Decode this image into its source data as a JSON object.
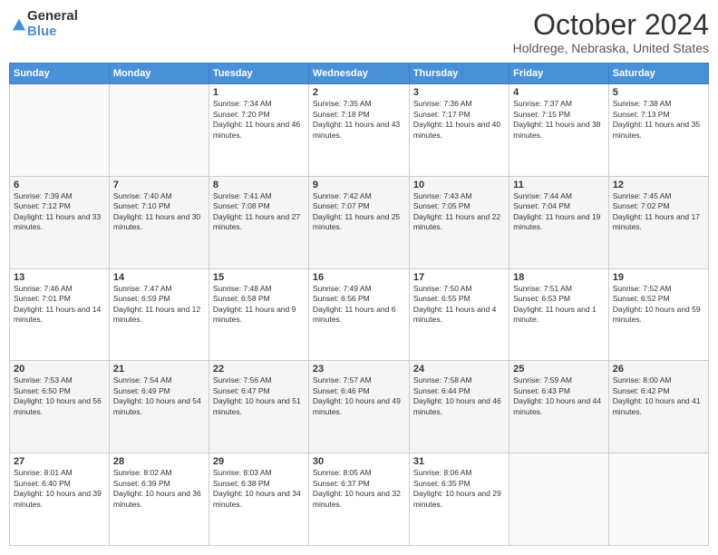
{
  "header": {
    "logo": {
      "general": "General",
      "blue": "Blue"
    },
    "title": "October 2024",
    "location": "Holdrege, Nebraska, United States"
  },
  "calendar": {
    "days_of_week": [
      "Sunday",
      "Monday",
      "Tuesday",
      "Wednesday",
      "Thursday",
      "Friday",
      "Saturday"
    ],
    "weeks": [
      [
        {
          "day": "",
          "info": ""
        },
        {
          "day": "",
          "info": ""
        },
        {
          "day": "1",
          "sunrise": "Sunrise: 7:34 AM",
          "sunset": "Sunset: 7:20 PM",
          "daylight": "Daylight: 11 hours and 46 minutes."
        },
        {
          "day": "2",
          "sunrise": "Sunrise: 7:35 AM",
          "sunset": "Sunset: 7:18 PM",
          "daylight": "Daylight: 11 hours and 43 minutes."
        },
        {
          "day": "3",
          "sunrise": "Sunrise: 7:36 AM",
          "sunset": "Sunset: 7:17 PM",
          "daylight": "Daylight: 11 hours and 40 minutes."
        },
        {
          "day": "4",
          "sunrise": "Sunrise: 7:37 AM",
          "sunset": "Sunset: 7:15 PM",
          "daylight": "Daylight: 11 hours and 38 minutes."
        },
        {
          "day": "5",
          "sunrise": "Sunrise: 7:38 AM",
          "sunset": "Sunset: 7:13 PM",
          "daylight": "Daylight: 11 hours and 35 minutes."
        }
      ],
      [
        {
          "day": "6",
          "sunrise": "Sunrise: 7:39 AM",
          "sunset": "Sunset: 7:12 PM",
          "daylight": "Daylight: 11 hours and 33 minutes."
        },
        {
          "day": "7",
          "sunrise": "Sunrise: 7:40 AM",
          "sunset": "Sunset: 7:10 PM",
          "daylight": "Daylight: 11 hours and 30 minutes."
        },
        {
          "day": "8",
          "sunrise": "Sunrise: 7:41 AM",
          "sunset": "Sunset: 7:08 PM",
          "daylight": "Daylight: 11 hours and 27 minutes."
        },
        {
          "day": "9",
          "sunrise": "Sunrise: 7:42 AM",
          "sunset": "Sunset: 7:07 PM",
          "daylight": "Daylight: 11 hours and 25 minutes."
        },
        {
          "day": "10",
          "sunrise": "Sunrise: 7:43 AM",
          "sunset": "Sunset: 7:05 PM",
          "daylight": "Daylight: 11 hours and 22 minutes."
        },
        {
          "day": "11",
          "sunrise": "Sunrise: 7:44 AM",
          "sunset": "Sunset: 7:04 PM",
          "daylight": "Daylight: 11 hours and 19 minutes."
        },
        {
          "day": "12",
          "sunrise": "Sunrise: 7:45 AM",
          "sunset": "Sunset: 7:02 PM",
          "daylight": "Daylight: 11 hours and 17 minutes."
        }
      ],
      [
        {
          "day": "13",
          "sunrise": "Sunrise: 7:46 AM",
          "sunset": "Sunset: 7:01 PM",
          "daylight": "Daylight: 11 hours and 14 minutes."
        },
        {
          "day": "14",
          "sunrise": "Sunrise: 7:47 AM",
          "sunset": "Sunset: 6:59 PM",
          "daylight": "Daylight: 11 hours and 12 minutes."
        },
        {
          "day": "15",
          "sunrise": "Sunrise: 7:48 AM",
          "sunset": "Sunset: 6:58 PM",
          "daylight": "Daylight: 11 hours and 9 minutes."
        },
        {
          "day": "16",
          "sunrise": "Sunrise: 7:49 AM",
          "sunset": "Sunset: 6:56 PM",
          "daylight": "Daylight: 11 hours and 6 minutes."
        },
        {
          "day": "17",
          "sunrise": "Sunrise: 7:50 AM",
          "sunset": "Sunset: 6:55 PM",
          "daylight": "Daylight: 11 hours and 4 minutes."
        },
        {
          "day": "18",
          "sunrise": "Sunrise: 7:51 AM",
          "sunset": "Sunset: 6:53 PM",
          "daylight": "Daylight: 11 hours and 1 minute."
        },
        {
          "day": "19",
          "sunrise": "Sunrise: 7:52 AM",
          "sunset": "Sunset: 6:52 PM",
          "daylight": "Daylight: 10 hours and 59 minutes."
        }
      ],
      [
        {
          "day": "20",
          "sunrise": "Sunrise: 7:53 AM",
          "sunset": "Sunset: 6:50 PM",
          "daylight": "Daylight: 10 hours and 56 minutes."
        },
        {
          "day": "21",
          "sunrise": "Sunrise: 7:54 AM",
          "sunset": "Sunset: 6:49 PM",
          "daylight": "Daylight: 10 hours and 54 minutes."
        },
        {
          "day": "22",
          "sunrise": "Sunrise: 7:56 AM",
          "sunset": "Sunset: 6:47 PM",
          "daylight": "Daylight: 10 hours and 51 minutes."
        },
        {
          "day": "23",
          "sunrise": "Sunrise: 7:57 AM",
          "sunset": "Sunset: 6:46 PM",
          "daylight": "Daylight: 10 hours and 49 minutes."
        },
        {
          "day": "24",
          "sunrise": "Sunrise: 7:58 AM",
          "sunset": "Sunset: 6:44 PM",
          "daylight": "Daylight: 10 hours and 46 minutes."
        },
        {
          "day": "25",
          "sunrise": "Sunrise: 7:59 AM",
          "sunset": "Sunset: 6:43 PM",
          "daylight": "Daylight: 10 hours and 44 minutes."
        },
        {
          "day": "26",
          "sunrise": "Sunrise: 8:00 AM",
          "sunset": "Sunset: 6:42 PM",
          "daylight": "Daylight: 10 hours and 41 minutes."
        }
      ],
      [
        {
          "day": "27",
          "sunrise": "Sunrise: 8:01 AM",
          "sunset": "Sunset: 6:40 PM",
          "daylight": "Daylight: 10 hours and 39 minutes."
        },
        {
          "day": "28",
          "sunrise": "Sunrise: 8:02 AM",
          "sunset": "Sunset: 6:39 PM",
          "daylight": "Daylight: 10 hours and 36 minutes."
        },
        {
          "day": "29",
          "sunrise": "Sunrise: 8:03 AM",
          "sunset": "Sunset: 6:38 PM",
          "daylight": "Daylight: 10 hours and 34 minutes."
        },
        {
          "day": "30",
          "sunrise": "Sunrise: 8:05 AM",
          "sunset": "Sunset: 6:37 PM",
          "daylight": "Daylight: 10 hours and 32 minutes."
        },
        {
          "day": "31",
          "sunrise": "Sunrise: 8:06 AM",
          "sunset": "Sunset: 6:35 PM",
          "daylight": "Daylight: 10 hours and 29 minutes."
        },
        {
          "day": "",
          "info": ""
        },
        {
          "day": "",
          "info": ""
        }
      ]
    ]
  }
}
